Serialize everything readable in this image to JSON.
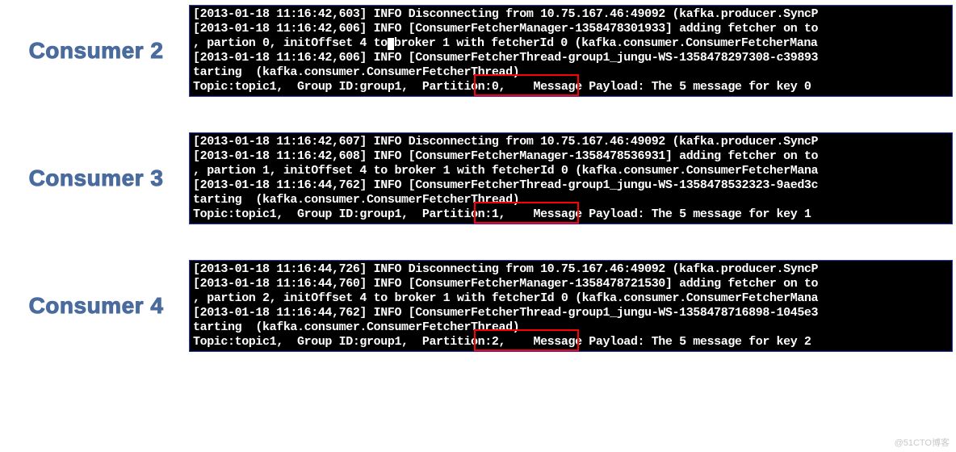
{
  "consumers": [
    {
      "label": "Consumer 2",
      "lines": [
        "[2013-01-18 11:16:42,603] INFO Disconnecting from 10.75.167.46:49092 (kafka.producer.SyncP",
        "[2013-01-18 11:16:42,606] INFO [ConsumerFetcherManager-1358478301933] adding fetcher on to",
        ", partion 0, initOffset 4 to broker 1 with fetcherId 0 (kafka.consumer.ConsumerFetcherMana",
        "[2013-01-18 11:16:42,606] INFO [ConsumerFetcherThread-group1_jungu-WS-1358478297308-c39893",
        "tarting  (kafka.consumer.ConsumerFetcherThread)",
        "Topic:topic1,  Group ID:group1,  Partition:0,    Message Payload: The 5 message for key 0 "
      ],
      "highlight": {
        "text": "Partition:0,",
        "cursor_after_to": true
      }
    },
    {
      "label": "Consumer 3",
      "lines": [
        "[2013-01-18 11:16:42,607] INFO Disconnecting from 10.75.167.46:49092 (kafka.producer.SyncP",
        "[2013-01-18 11:16:42,608] INFO [ConsumerFetcherManager-1358478536931] adding fetcher on to",
        ", partion 1, initOffset 4 to broker 1 with fetcherId 0 (kafka.consumer.ConsumerFetcherMana",
        "[2013-01-18 11:16:44,762] INFO [ConsumerFetcherThread-group1_jungu-WS-1358478532323-9aed3c",
        "tarting  (kafka.consumer.ConsumerFetcherThread)",
        "Topic:topic1,  Group ID:group1,  Partition:1,    Message Payload: The 5 message for key 1 "
      ],
      "highlight": {
        "text": "Partition:1,"
      }
    },
    {
      "label": "Consumer 4",
      "lines": [
        "[2013-01-18 11:16:44,726] INFO Disconnecting from 10.75.167.46:49092 (kafka.producer.SyncP",
        "[2013-01-18 11:16:44,760] INFO [ConsumerFetcherManager-1358478721530] adding fetcher on to",
        ", partion 2, initOffset 4 to broker 1 with fetcherId 0 (kafka.consumer.ConsumerFetcherMana",
        "[2013-01-18 11:16:44,762] INFO [ConsumerFetcherThread-group1_jungu-WS-1358478716898-1045e3",
        "tarting  (kafka.consumer.ConsumerFetcherThread)",
        "Topic:topic1,  Group ID:group1,  Partition:2,    Message Payload: The 5 message for key 2 "
      ],
      "highlight": {
        "text": "Partition:2,"
      }
    }
  ],
  "watermark": "@51CTO博客"
}
